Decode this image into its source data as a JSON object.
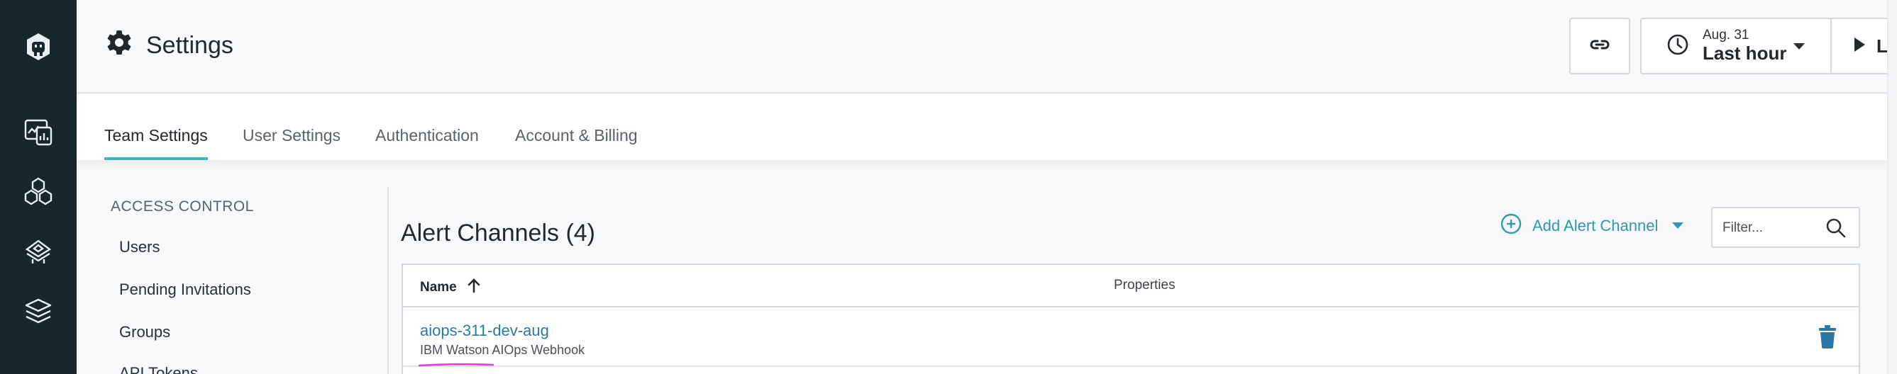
{
  "header": {
    "title": "Settings",
    "time_date": "Aug. 31",
    "time_range": "Last hour",
    "live_label": "Live"
  },
  "tabs": [
    {
      "label": "Team Settings",
      "active": true
    },
    {
      "label": "User Settings",
      "active": false
    },
    {
      "label": "Authentication",
      "active": false
    },
    {
      "label": "Account & Billing",
      "active": false
    }
  ],
  "sidenav": {
    "heading": "ACCESS CONTROL",
    "items": [
      "Users",
      "Pending Invitations",
      "Groups",
      "API Tokens"
    ]
  },
  "main": {
    "title": "Alert Channels (4)",
    "add_button": "Add Alert Channel",
    "filter_placeholder": "Filter..."
  },
  "table": {
    "columns": [
      "Name",
      "Properties"
    ],
    "rows": [
      {
        "name": "aiops-311-dev-aug",
        "type": "IBM Watson AIOps Webhook"
      }
    ]
  },
  "colors": {
    "rail": "#18262d",
    "accent_teal": "#3fb3b8",
    "link_blue": "#2b78a6",
    "annotation_magenta": "#e040d0"
  },
  "icons": {
    "rail": [
      "app-logo-icon",
      "dashboard-icon",
      "infrastructure-icon",
      "alerts-icon",
      "layers-icon"
    ],
    "header": [
      "gear-icon",
      "link-icon",
      "clock-icon",
      "chevron-down-icon",
      "play-icon"
    ],
    "main": [
      "add-circle-icon",
      "search-icon",
      "sort-up-icon",
      "trash-icon"
    ]
  }
}
